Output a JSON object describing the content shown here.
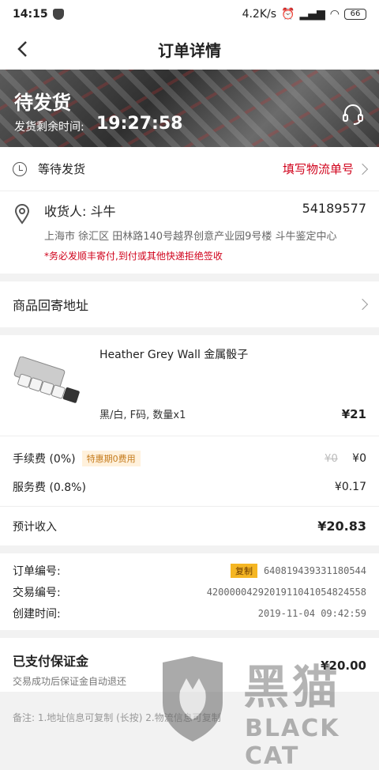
{
  "statusbar": {
    "time": "14:15",
    "net_speed": "4.2K/s",
    "battery": "66"
  },
  "navbar": {
    "title": "订单详情"
  },
  "banner": {
    "status": "待发货",
    "timer_label": "发货剩余时间:",
    "timer": "19:27:58"
  },
  "shipping": {
    "status": "等待发货",
    "action": "填写物流单号"
  },
  "address": {
    "recipient": "收货人: 斗牛",
    "phone": "54189577",
    "detail": "上海市 徐汇区 田林路140号越界创意产业园9号楼   斗牛鉴定中心",
    "warning": "*务必发顺丰寄付,到付或其他快递拒绝签收"
  },
  "return_address": {
    "label": "商品回寄地址"
  },
  "product": {
    "name": "Heather Grey Wall 金属骰子",
    "spec": "黑/白,  F码,  数量x1",
    "price": "¥21"
  },
  "fees": {
    "handling_label": "手续费 (0%)",
    "handling_tag": "特惠期0费用",
    "handling_original": "¥0",
    "handling_value": "¥0",
    "service_label": "服务费 (0.8%)",
    "service_value": "¥0.17",
    "income_label": "预计收入",
    "income_value": "¥20.83"
  },
  "order": {
    "order_no_label": "订单编号:",
    "copy_label": "复制",
    "order_no": "640819439331180544",
    "trade_no_label": "交易编号:",
    "trade_no": "4200000429201911041054824558",
    "created_label": "创建时间:",
    "created": "2019-11-04 09:42:59"
  },
  "deposit": {
    "title": "已支付保证金",
    "subtitle": "交易成功后保证金自动退还",
    "amount": "¥20.00"
  },
  "note": "备注: 1.地址信息可复制 (长按) 2.物流信息可复制",
  "watermark": {
    "cn": "黑猫",
    "en": "BLACK CAT"
  }
}
